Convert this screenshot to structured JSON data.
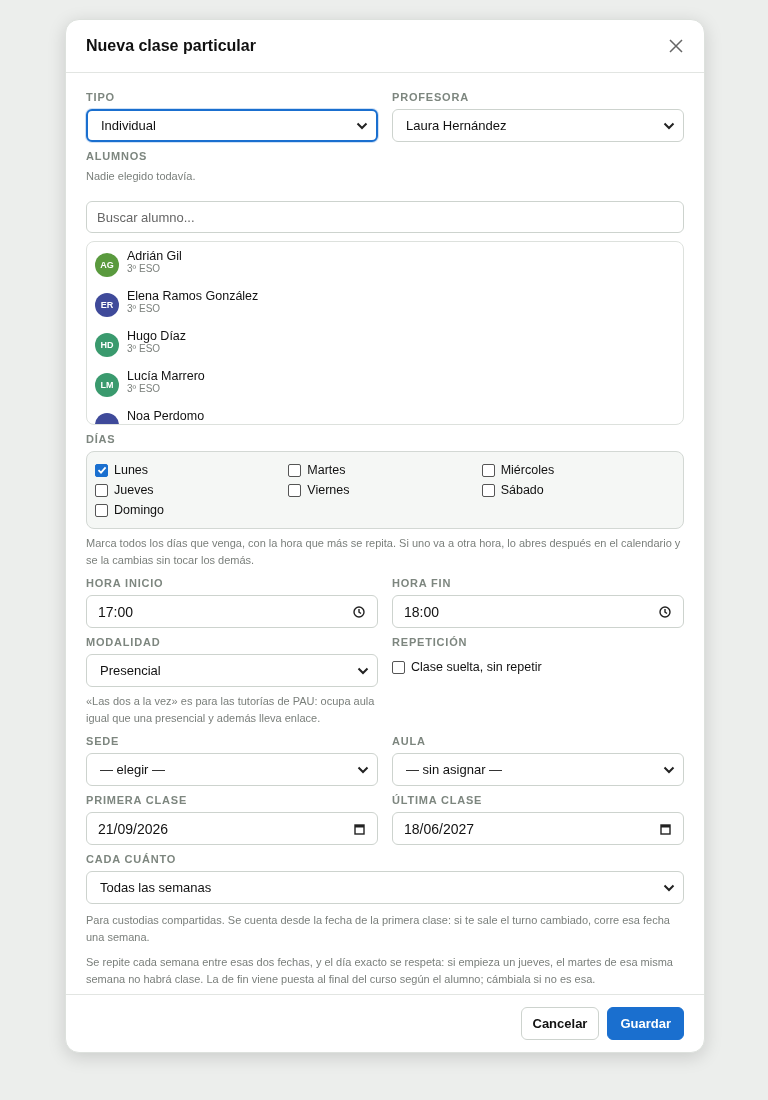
{
  "dialog": {
    "title": "Nueva clase particular"
  },
  "tipo": {
    "label": "TIPO",
    "value": "Individual",
    "focused": true
  },
  "profesora": {
    "label": "PROFESORA",
    "value": "Laura Hernández"
  },
  "alumnos": {
    "label": "ALUMNOS",
    "empty_note": "Nadie elegido todavía.",
    "search": {
      "placeholder": "Buscar alumno..."
    },
    "items": [
      {
        "initials": "AG",
        "name": "Adrián Gil",
        "course": "3º ESO",
        "color": "#5a9a3e"
      },
      {
        "initials": "ER",
        "name": "Elena Ramos González",
        "course": "3º ESO",
        "color": "#3f4a9a"
      },
      {
        "initials": "HD",
        "name": "Hugo Díaz",
        "course": "3º ESO",
        "color": "#3a9a6e"
      },
      {
        "initials": "LM",
        "name": "Lucía Marrero",
        "course": "3º ESO",
        "color": "#3a9a6e"
      },
      {
        "name": "Noa Perdomo",
        "color": "#3f4a9a"
      }
    ]
  },
  "dias": {
    "label": "DÍAS",
    "items": [
      {
        "label": "Lunes",
        "checked": true
      },
      {
        "label": "Martes",
        "checked": false
      },
      {
        "label": "Miércoles",
        "checked": false
      },
      {
        "label": "Jueves",
        "checked": false
      },
      {
        "label": "Viernes",
        "checked": false
      },
      {
        "label": "Sábado",
        "checked": false
      },
      {
        "label": "Domingo",
        "checked": false
      }
    ],
    "hint": "Marca todos los días que venga, con la hora que más se repita. Si uno va a otra hora, lo abres después en el calendario y se la cambias sin tocar los demás."
  },
  "hora_inicio": {
    "label": "HORA INICIO",
    "value": "17:00"
  },
  "hora_fin": {
    "label": "HORA FIN",
    "value": "18:00"
  },
  "modalidad": {
    "label": "MODALIDAD",
    "value": "Presencial",
    "hint": "«Las dos a la vez» es para las tutorías de PAU: ocupa aula igual que una presencial y además lleva enlace."
  },
  "repeticion": {
    "label": "REPETICIÓN",
    "option": "Clase suelta, sin repetir",
    "checked": false
  },
  "sede": {
    "label": "SEDE",
    "value": "— elegir —"
  },
  "aula": {
    "label": "AULA",
    "value": "— sin asignar —"
  },
  "primera_clase": {
    "label": "PRIMERA CLASE",
    "value": "21/09/2026"
  },
  "ultima_clase": {
    "label": "ÚLTIMA CLASE",
    "value": "18/06/2027"
  },
  "cada_cuanto": {
    "label": "CADA CUÁNTO",
    "value": "Todas las semanas",
    "hints": [
      "Para custodias compartidas. Se cuenta desde la fecha de la primera clase: si te sale el turno cambiado, corre esa fecha una semana.",
      "Se repite cada semana entre esas dos fechas, y el día exacto se respeta: si empieza un jueves, el martes de esa misma semana no habrá clase. La de fin viene puesta al final del curso según el alumno; cámbiala si no es esa."
    ]
  },
  "buttons": {
    "cancel": "Cancelar",
    "save": "Guardar"
  }
}
